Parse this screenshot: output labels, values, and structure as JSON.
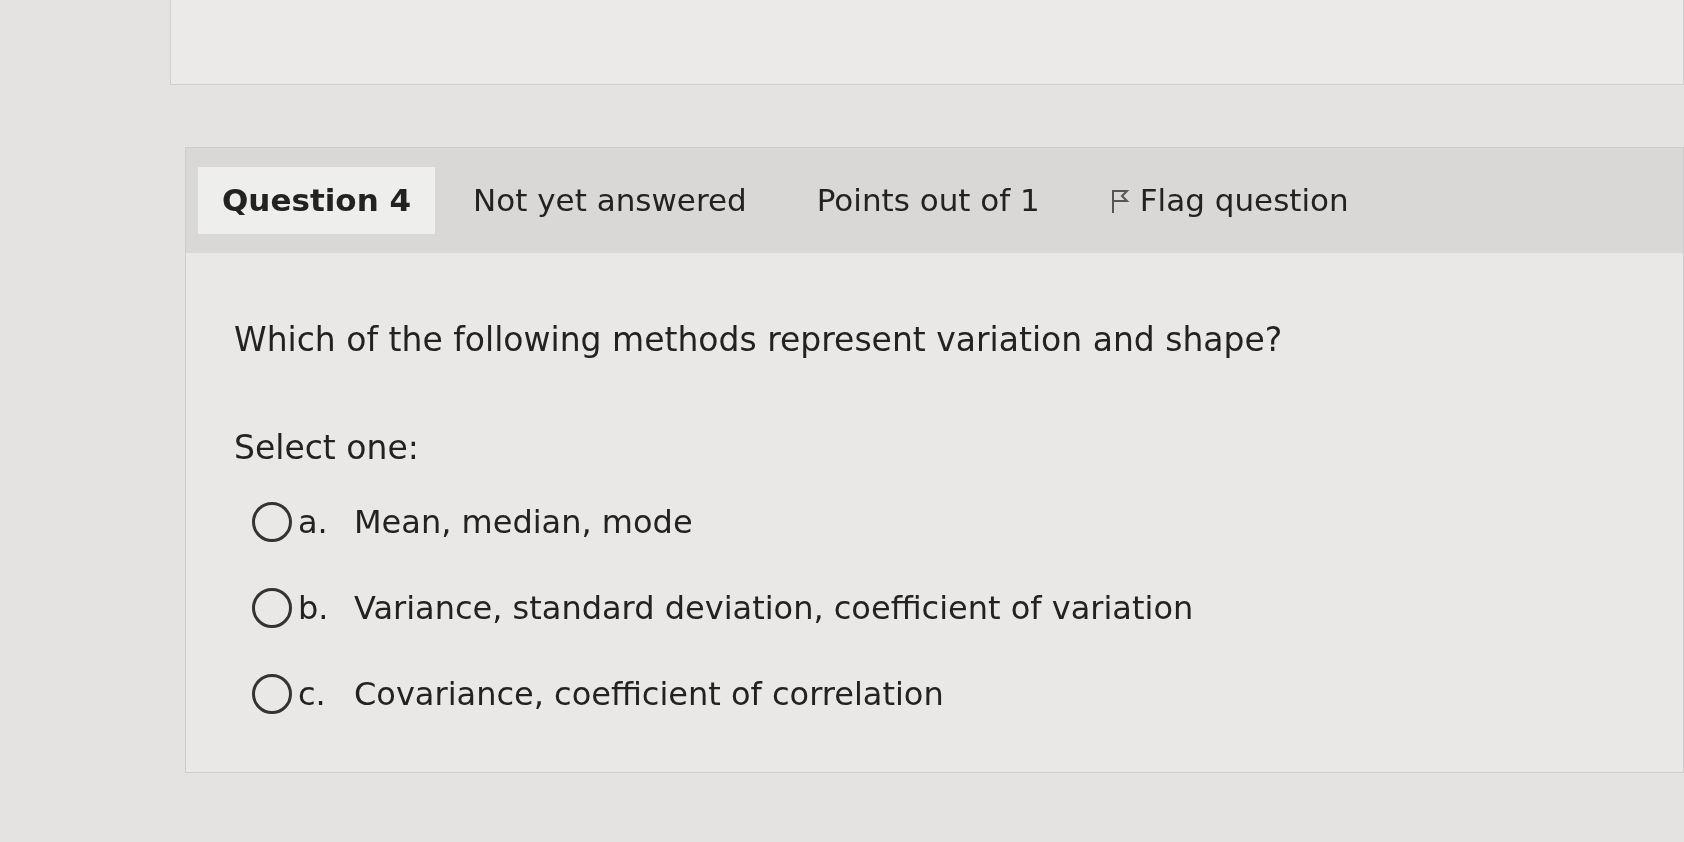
{
  "question": {
    "number": "Question 4",
    "status": "Not yet answered",
    "points": "Points out of 1",
    "flag": {
      "label": "Flag question",
      "flagged": false
    }
  },
  "prompt": "Which of the following methods represent variation and shape?",
  "instruction": "Select one:",
  "options": [
    {
      "letter": "a.",
      "text": "Mean, median, mode",
      "selected": false
    },
    {
      "letter": "b.",
      "text": "Variance, standard deviation, coefficient of variation",
      "selected": false
    },
    {
      "letter": "c.",
      "text": "Covariance, coefficient of correlation",
      "selected": false
    }
  ]
}
